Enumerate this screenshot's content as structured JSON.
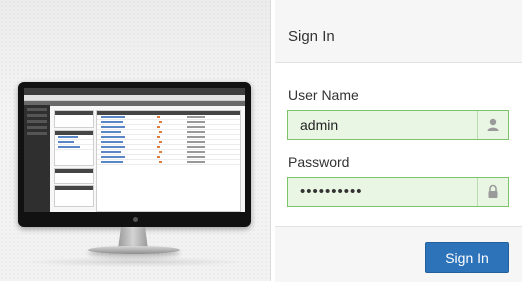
{
  "signin": {
    "title": "Sign In",
    "username_label": "User Name",
    "username_value": "admin",
    "password_label": "Password",
    "password_value": "••••••••••",
    "submit_label": "Sign In"
  },
  "colors": {
    "primary_button": "#2d73b9",
    "field_border": "#7cc36a",
    "field_background": "#eaf6e4"
  },
  "icons": {
    "username_addon": "user-icon",
    "password_addon": "lock-icon"
  }
}
